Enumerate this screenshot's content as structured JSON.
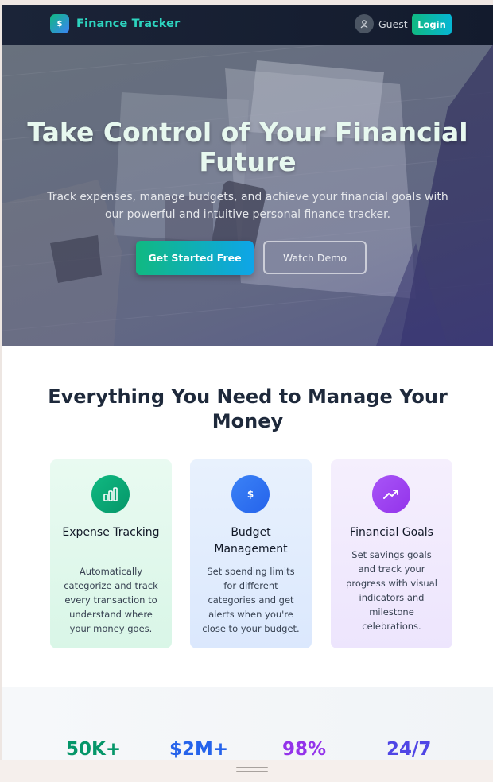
{
  "nav": {
    "brand_icon": "$",
    "brand_name": "Finance Tracker",
    "user_label": "Guest",
    "login_label": "Login"
  },
  "hero": {
    "title": "Take Control of Your Financial Future",
    "subtitle": "Track expenses, manage budgets, and achieve your financial goals with our powerful and intuitive personal finance tracker.",
    "primary_cta": "Get Started Free",
    "secondary_cta": "Watch Demo",
    "background_icon": "finance-desk-photo"
  },
  "features": {
    "title": "Everything You Need to Manage Your Money",
    "cards": [
      {
        "title": "Expense Tracking",
        "text": "Automatically categorize and track every transaction to understand where your money goes.",
        "icon": "bar-chart-icon",
        "color": "#10b981"
      },
      {
        "title": "Budget Management",
        "text": "Set spending limits for different categories and get alerts when you're close to your budget.",
        "icon_text": "$",
        "icon": "dollar-icon",
        "color": "#3b82f6"
      },
      {
        "title": "Financial Goals",
        "text": "Set savings goals and track your progress with visual indicators and milestone celebrations.",
        "icon": "trending-up-icon",
        "color": "#a855f7"
      }
    ]
  },
  "stats": [
    {
      "value": "50K+",
      "color": "#059669"
    },
    {
      "value": "$2M+",
      "color": "#2563eb"
    },
    {
      "value": "98%",
      "color": "#9333ea"
    },
    {
      "value": "24/7",
      "color": "#4f46e5"
    }
  ]
}
